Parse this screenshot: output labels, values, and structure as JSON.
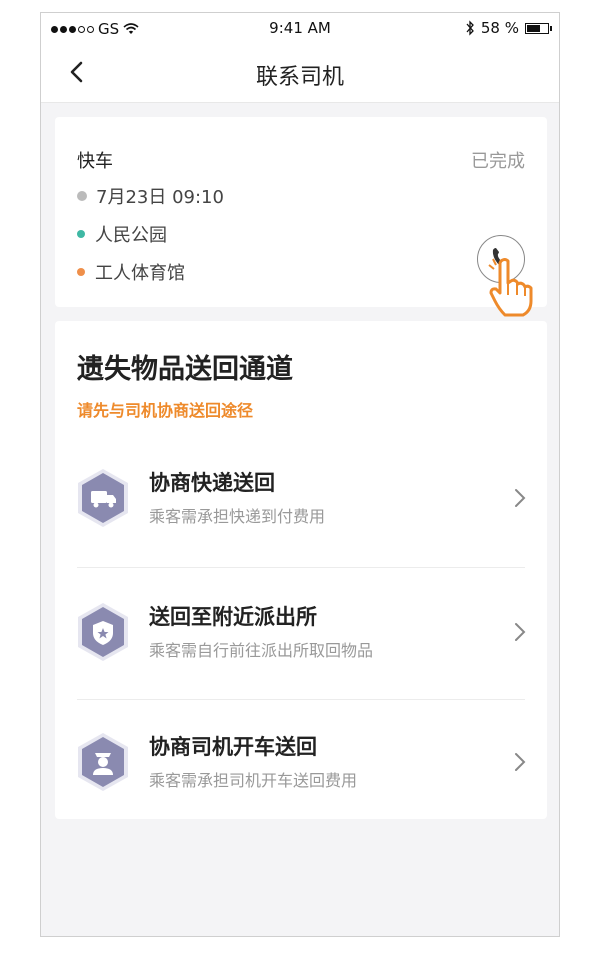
{
  "status_bar": {
    "carrier": "GS",
    "time": "9:41 AM",
    "battery_text": "58 %",
    "battery_level": 0.58
  },
  "nav": {
    "title": "联系司机",
    "back_icon": "chevron-left-icon"
  },
  "trip": {
    "type": "快车",
    "status": "已完成",
    "time": "7月23日 09:10",
    "start": "人民公园",
    "end": "工人体育馆",
    "start_color": "#3fb8a4",
    "end_color": "#ef8f4a",
    "call_icon": "phone-icon",
    "hand_icon": "hand-pointer-icon"
  },
  "lost": {
    "title": "遗失物品送回通道",
    "subtitle": "请先与司机协商送回途径",
    "accent": "#ee8a2b",
    "options": [
      {
        "title": "协商快递送回",
        "desc": "乘客需承担快递到付费用",
        "icon": "truck-icon"
      },
      {
        "title": "送回至附近派出所",
        "desc": "乘客需自行前往派出所取回物品",
        "icon": "police-badge-icon"
      },
      {
        "title": "协商司机开车送回",
        "desc": "乘客需承担司机开车送回费用",
        "icon": "driver-icon"
      }
    ]
  }
}
